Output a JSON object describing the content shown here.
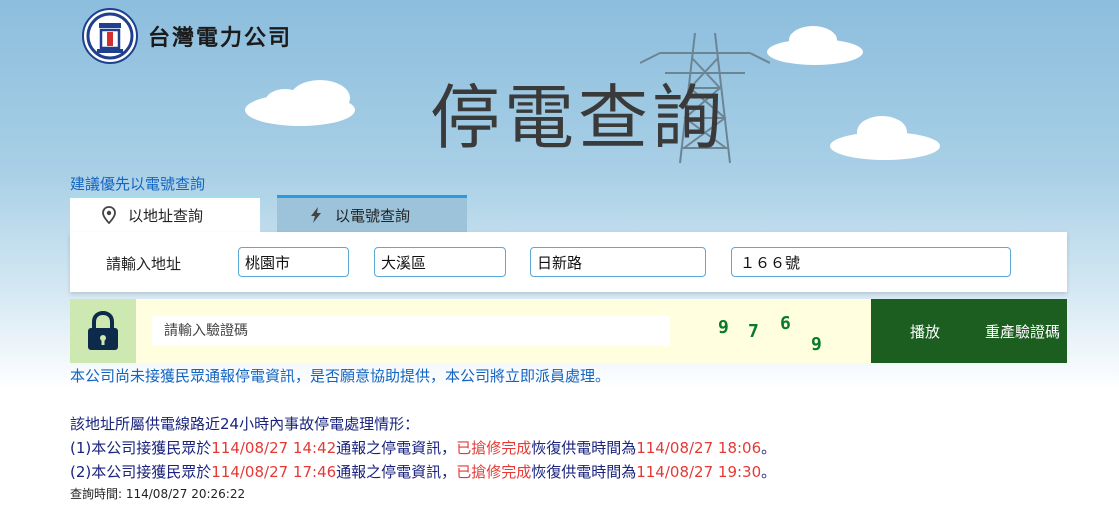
{
  "header": {
    "company_name": "台灣電力公司",
    "page_title": "停電查詢"
  },
  "suggestion": "建議優先以電號查詢",
  "tabs": [
    {
      "label": "以地址查詢",
      "icon": "map-pin-icon",
      "active": true
    },
    {
      "label": "以電號查詢",
      "icon": "lightning-icon",
      "active": false
    }
  ],
  "address": {
    "label": "請輸入地址",
    "city": "桃園市",
    "district": "大溪區",
    "road": "日新路",
    "number": "１６６號"
  },
  "captcha": {
    "placeholder": "請輸入驗證碼",
    "digits": [
      "9",
      "7",
      "6",
      "9"
    ],
    "play_label": "播放",
    "regenerate_label": "重產驗證碼",
    "color": "#0a7a2a"
  },
  "notice": "本公司尚未接獲民眾通報停電資訊，是否願意協助提供，本公司將立即派員處理。",
  "outage": {
    "heading": "該地址所屬供電線路近24小時內事故停電處理情形：",
    "rows": [
      {
        "prefix": "(1)本公司接獲民眾於",
        "report_time": "114/08/27 14:42",
        "middle": "通報之停電資訊，",
        "status": "已搶修完成",
        "restore_label": "恢復供電時間為",
        "restore_time": "114/08/27 18:06",
        "suffix": "。"
      },
      {
        "prefix": "(2)本公司接獲民眾於",
        "report_time": "114/08/27 17:46",
        "middle": "通報之停電資訊，",
        "status": "已搶修完成",
        "restore_label": "恢復供電時間為",
        "restore_time": "114/08/27 19:30",
        "suffix": "。"
      }
    ]
  },
  "query_time": "查詢時間: 114/08/27 20:26:22",
  "colors": {
    "accent_blue": "#1565c0",
    "red": "#e53935",
    "dark_green": "#1b5e20"
  }
}
